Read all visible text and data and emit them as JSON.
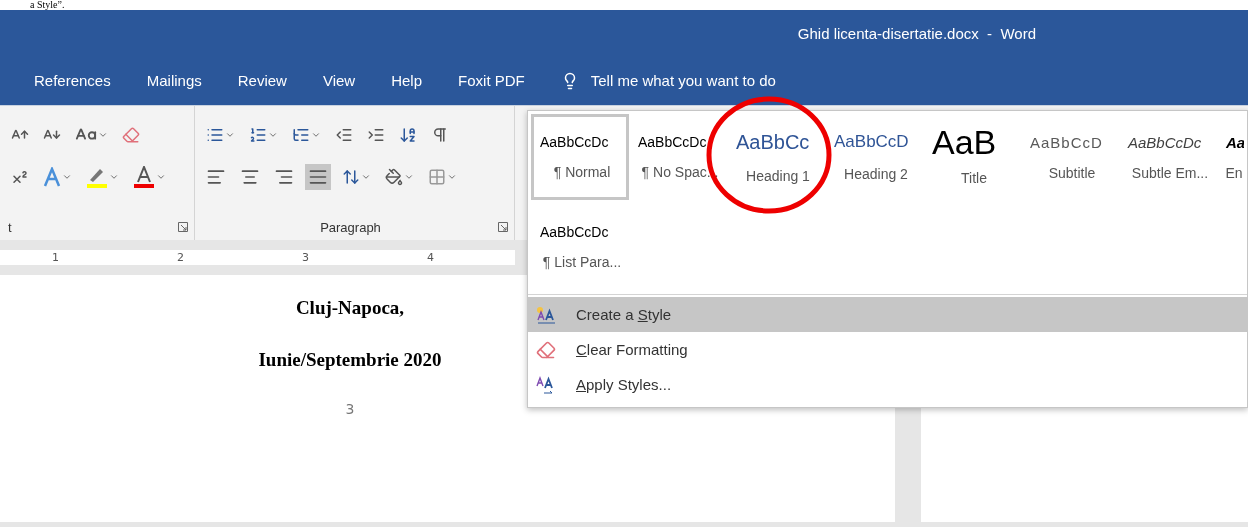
{
  "caption": "a Style”.",
  "window": {
    "title": "Ghid licenta-disertatie.docx  -  Word"
  },
  "tabs": [
    {
      "label": "References"
    },
    {
      "label": "Mailings"
    },
    {
      "label": "Review"
    },
    {
      "label": "View"
    },
    {
      "label": "Help"
    },
    {
      "label": "Foxit PDF"
    }
  ],
  "tell_me": {
    "placeholder": "Tell me what you want to do"
  },
  "font_group": {
    "label": "t"
  },
  "paragraph_group": {
    "label": "Paragraph",
    "alignments": [
      {
        "kind": "left",
        "selected": false
      },
      {
        "kind": "center",
        "selected": false
      },
      {
        "kind": "right",
        "selected": false
      },
      {
        "kind": "justify",
        "selected": true
      }
    ]
  },
  "ruler": {
    "marks": [
      "1",
      "2",
      "3",
      "4"
    ]
  },
  "styles_gallery": {
    "rows": [
      {
        "styles": [
          {
            "kind": "normal",
            "sample": "AaBbCcDc",
            "label": "¶ Normal",
            "selected": true
          },
          {
            "kind": "no_spacing",
            "sample": "AaBbCcDc",
            "label": "¶ No Spac...",
            "selected": false
          },
          {
            "kind": "heading1",
            "sample": "AaBbCc",
            "label": "Heading 1",
            "selected": false
          },
          {
            "kind": "heading2",
            "sample": "AaBbCcD",
            "label": "Heading 2",
            "selected": false
          },
          {
            "kind": "title",
            "sample": "AaB",
            "label": "Title",
            "selected": false
          },
          {
            "kind": "subtitle",
            "sample": "AaBbCcD",
            "label": "Subtitle",
            "selected": false
          },
          {
            "kind": "subtle_emphasis",
            "sample": "AaBbCcDc",
            "label": "Subtle Em...",
            "selected": false
          },
          {
            "kind": "emphasis",
            "sample": "Aa",
            "label": "En",
            "selected": false
          }
        ]
      },
      {
        "styles": [
          {
            "kind": "normal",
            "sample": "AaBbCcDc",
            "label": "¶ List Para...",
            "selected": false
          }
        ]
      }
    ],
    "menu": [
      {
        "kind": "create",
        "before": "Create a ",
        "key": "S",
        "after": "tyle",
        "selected": true
      },
      {
        "kind": "clear",
        "key": "C",
        "after": "lear Formatting",
        "selected": false
      },
      {
        "kind": "apply",
        "key": "A",
        "after": "pply Styles...",
        "selected": false
      }
    ]
  },
  "document": {
    "lines": [
      "Cluj-Napoca,",
      "Iunie/Septembrie 2020"
    ],
    "page_number": "3"
  }
}
